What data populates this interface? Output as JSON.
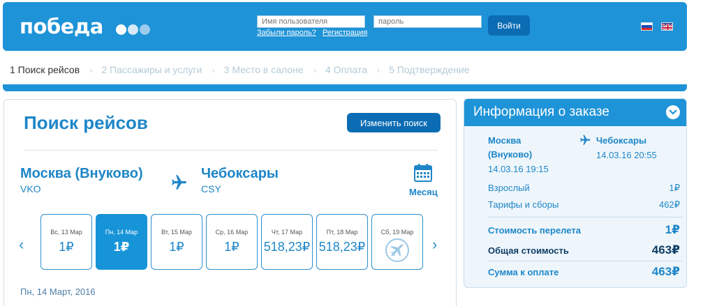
{
  "header": {
    "logo_text": "победа",
    "logo_dot_colors": [
      "#ffffff",
      "#d7e9f6",
      "#9ccbec"
    ],
    "username_placeholder": "Имя пользователя",
    "password_placeholder": "пароль",
    "forgot_link": "Забыли пароль?",
    "register_link": "Регистрация",
    "login_button": "Войти"
  },
  "steps": [
    "1 Поиск рейсов",
    "2 Пассажиры и услуги",
    "3 Место в салоне",
    "4 Оплата",
    "5 Подтверждение"
  ],
  "steps_separator": "›",
  "main": {
    "title": "Поиск рейсов",
    "change_search_button": "Изменить поиск",
    "origin_city": "Москва (Внуково)",
    "origin_code": "VKO",
    "destination_city": "Чебоксары",
    "destination_code": "CSY",
    "calendar_label": "Месяц",
    "prev_arrow": "‹",
    "next_arrow": "›",
    "days": [
      {
        "label": "Вс, 13 Мар",
        "price": "1₽",
        "selected": false
      },
      {
        "label": "Пн, 14 Мар",
        "price": "1₽",
        "selected": true
      },
      {
        "label": "Вт, 15 Мар",
        "price": "1₽",
        "selected": false
      },
      {
        "label": "Ср, 16 Мар",
        "price": "1₽",
        "selected": false
      },
      {
        "label": "Чт, 17 Мар",
        "price": "518,23₽",
        "selected": false
      },
      {
        "label": "Пт, 18 Мар",
        "price": "518,23₽",
        "selected": false
      },
      {
        "label": "Сб, 19 Мар",
        "price": "",
        "selected": false
      }
    ],
    "selected_date": "Пн, 14 Март, 2016"
  },
  "order": {
    "title": "Информация о заказе",
    "origin_line1": "Москва",
    "origin_line2": "(Внуково)",
    "departure": "14.03.16 19:15",
    "destination": "Чебоксары",
    "arrival": "14.03.16 20:55",
    "adult_label": "Взрослый",
    "adult_value": "1₽",
    "fees_label": "Тарифы и сборы",
    "fees_value": "462₽",
    "flight_cost_label": "Стоимость перелета",
    "flight_cost_value": "1₽",
    "total_label": "Общая стоимость",
    "total_value": "463₽",
    "pay_label": "Сумма к оплате",
    "pay_value": "463₽"
  },
  "colors": {
    "brand_blue": "#1e93d7",
    "button_blue": "#0b6cb3",
    "text_blue": "#1e86c8"
  },
  "icons": {
    "route": "airplane-icon",
    "calendar": "calendar-icon",
    "no_flights": "no-flight-icon",
    "collapse": "chevron-down-icon"
  }
}
